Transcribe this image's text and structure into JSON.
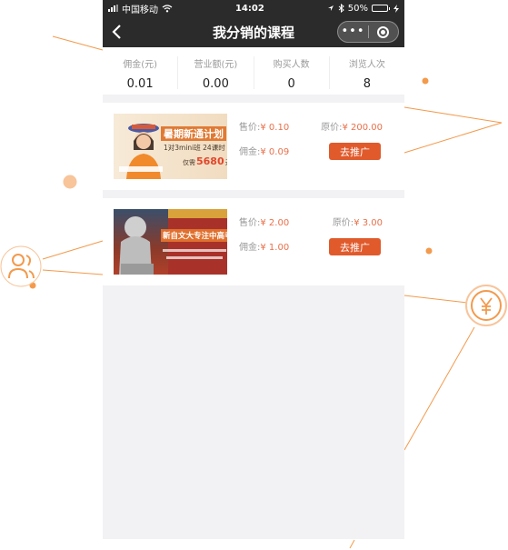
{
  "status_bar": {
    "carrier": "中国移动",
    "time": "14:02",
    "battery": "50%",
    "battery_level": 0.5
  },
  "navbar": {
    "title": "我分销的课程"
  },
  "stats": [
    {
      "label": "佣金(元)",
      "value": "0.01"
    },
    {
      "label": "营业额(元)",
      "value": "0.00"
    },
    {
      "label": "购买人数",
      "value": "0"
    },
    {
      "label": "浏览人次",
      "value": "8"
    }
  ],
  "courses": [
    {
      "banner_title": "暑期新通计划",
      "banner_line": "1对3mini班 24课时",
      "banner_price": "5680",
      "banner_price_prefix": "仅需",
      "banner_price_unit": "元",
      "sale_label": "售价:",
      "sale_price": "¥ 0.10",
      "orig_label": "原价:",
      "orig_price": "¥ 200.00",
      "commission_label": "佣金:",
      "commission": "¥ 0.09",
      "button": "去推广"
    },
    {
      "banner_title": "新自文大专注中高考",
      "sale_label": "售价:",
      "sale_price": "¥ 2.00",
      "orig_label": "原价:",
      "orig_price": "¥ 3.00",
      "commission_label": "佣金:",
      "commission": "¥ 1.00",
      "button": "去推广"
    }
  ],
  "colors": {
    "accent": "#e05a2c",
    "price": "#e9704a",
    "decor": "#f39a4c",
    "header": "#2b2b2b"
  },
  "icons": [
    "back-arrow-icon",
    "wifi-icon",
    "location-icon",
    "bluetooth-icon",
    "more-icon",
    "close-ring-icon",
    "user-group-icon",
    "yen-icon"
  ]
}
